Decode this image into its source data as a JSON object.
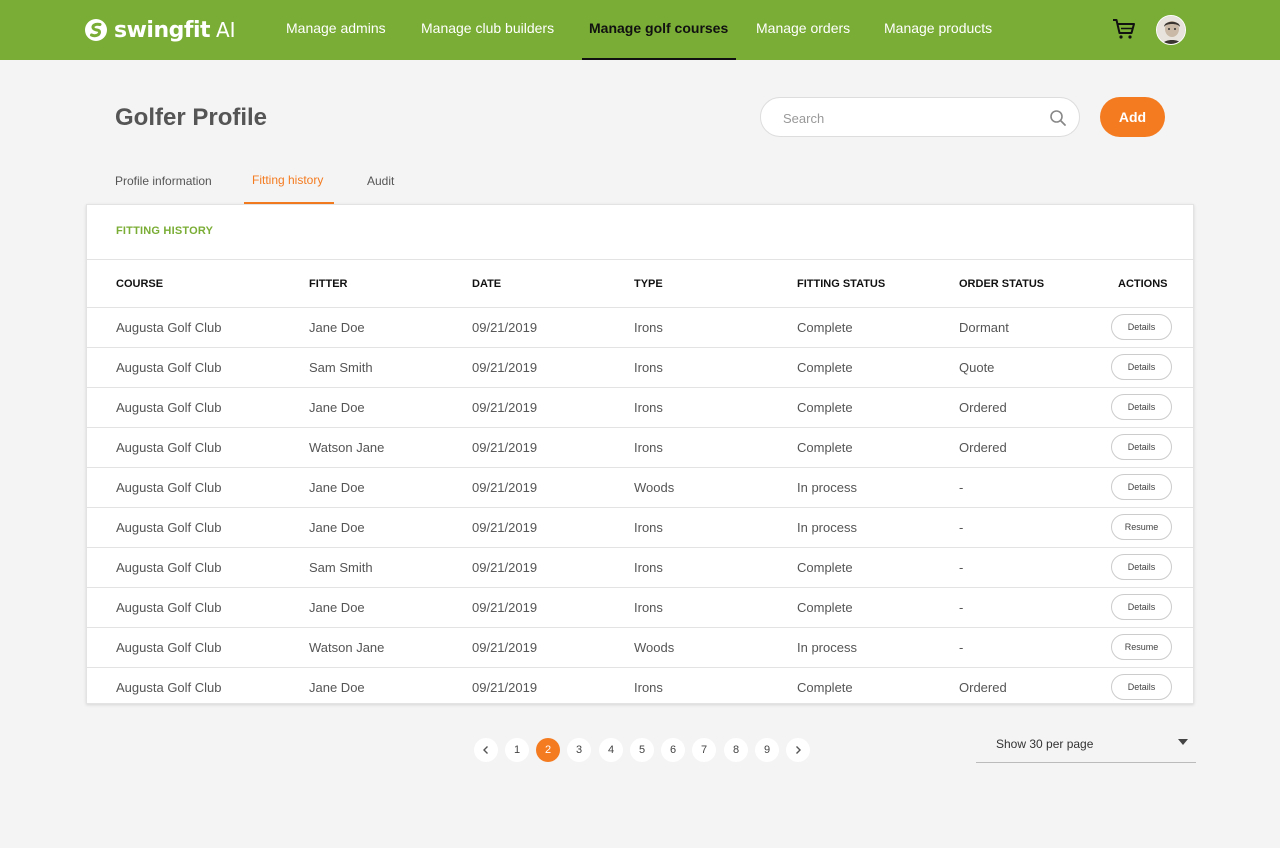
{
  "header": {
    "logo_text": "swingfit",
    "logo_suffix": "AI",
    "nav": [
      {
        "label": "Manage admins",
        "active": false
      },
      {
        "label": "Manage club builders",
        "active": false
      },
      {
        "label": "Manage golf courses",
        "active": true
      },
      {
        "label": "Manage orders",
        "active": false
      },
      {
        "label": "Manage products",
        "active": false
      }
    ],
    "cart_icon": "cart-icon",
    "avatar_icon": "user-avatar"
  },
  "page": {
    "title": "Golfer Profile",
    "search_placeholder": "Search",
    "add_label": "Add"
  },
  "tabs": [
    {
      "label": "Profile information",
      "active": false
    },
    {
      "label": "Fitting history",
      "active": true
    },
    {
      "label": "Audit",
      "active": false
    }
  ],
  "card": {
    "title": "FITTING HISTORY",
    "columns": [
      "COURSE",
      "FITTER",
      "DATE",
      "TYPE",
      "FITTING STATUS",
      "ORDER STATUS",
      "ACTIONS"
    ],
    "rows": [
      {
        "course": "Augusta Golf Club",
        "fitter": "Jane Doe",
        "date": "09/21/2019",
        "type": "Irons",
        "fitting_status": "Complete",
        "order_status": "Dormant",
        "action": "Details"
      },
      {
        "course": "Augusta Golf Club",
        "fitter": "Sam Smith",
        "date": "09/21/2019",
        "type": "Irons",
        "fitting_status": "Complete",
        "order_status": "Quote",
        "action": "Details"
      },
      {
        "course": "Augusta Golf Club",
        "fitter": "Jane Doe",
        "date": "09/21/2019",
        "type": "Irons",
        "fitting_status": "Complete",
        "order_status": "Ordered",
        "action": "Details"
      },
      {
        "course": "Augusta Golf Club",
        "fitter": "Watson Jane",
        "date": "09/21/2019",
        "type": "Irons",
        "fitting_status": "Complete",
        "order_status": "Ordered",
        "action": "Details"
      },
      {
        "course": "Augusta Golf Club",
        "fitter": "Jane Doe",
        "date": "09/21/2019",
        "type": "Woods",
        "fitting_status": "In process",
        "order_status": "-",
        "action": "Details"
      },
      {
        "course": "Augusta Golf Club",
        "fitter": "Jane Doe",
        "date": "09/21/2019",
        "type": "Irons",
        "fitting_status": "In process",
        "order_status": "-",
        "action": "Resume"
      },
      {
        "course": "Augusta Golf Club",
        "fitter": "Sam Smith",
        "date": "09/21/2019",
        "type": "Irons",
        "fitting_status": "Complete",
        "order_status": "-",
        "action": "Details"
      },
      {
        "course": "Augusta Golf Club",
        "fitter": "Jane Doe",
        "date": "09/21/2019",
        "type": "Irons",
        "fitting_status": "Complete",
        "order_status": "-",
        "action": "Details"
      },
      {
        "course": "Augusta Golf Club",
        "fitter": "Watson Jane",
        "date": "09/21/2019",
        "type": "Woods",
        "fitting_status": "In process",
        "order_status": "-",
        "action": "Resume"
      },
      {
        "course": "Augusta Golf Club",
        "fitter": "Jane Doe",
        "date": "09/21/2019",
        "type": "Irons",
        "fitting_status": "Complete",
        "order_status": "Ordered",
        "action": "Details"
      }
    ]
  },
  "pagination": {
    "pages": [
      "1",
      "2",
      "3",
      "4",
      "5",
      "6",
      "7",
      "8",
      "9"
    ],
    "current": "2",
    "per_page_label": "Show 30 per page"
  },
  "colors": {
    "brand_green": "#7aad35",
    "accent_orange": "#f47b20"
  }
}
